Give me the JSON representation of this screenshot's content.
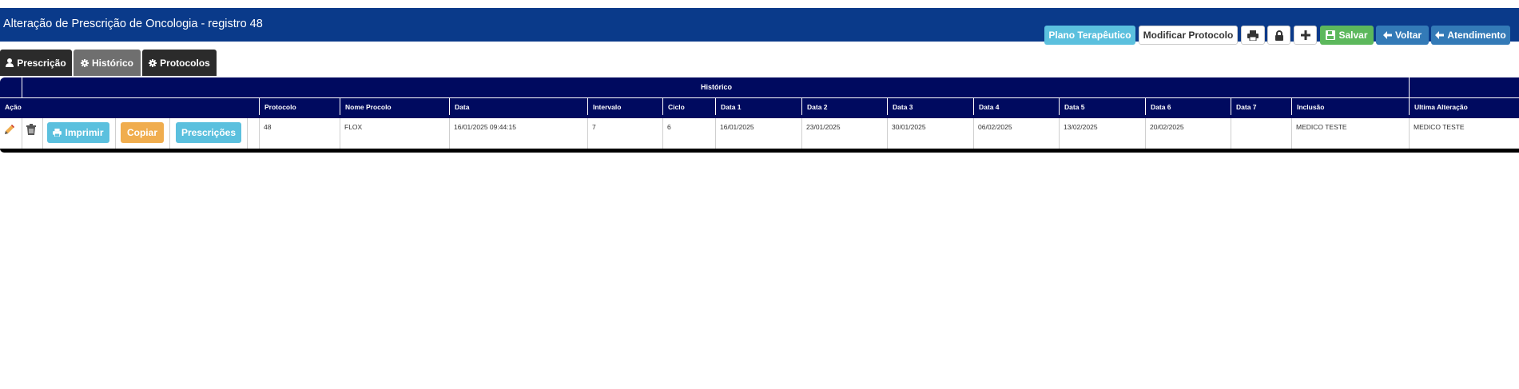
{
  "header": {
    "title": "Alteração de Prescrição de Oncologia - registro 48",
    "plano_label": "Plano Terapêutico",
    "modificar_label": "Modificar Protocolo",
    "salvar_label": "Salvar",
    "voltar_label": "Voltar",
    "atendimento_label": "Atendimento"
  },
  "tabs": [
    {
      "label": "Prescrição",
      "icon": "user-icon"
    },
    {
      "label": "Histórico",
      "icon": "gear-icon",
      "active": true
    },
    {
      "label": "Protocolos",
      "icon": "gear-icon"
    }
  ],
  "table": {
    "title": "Histórico",
    "columns": [
      "Ação",
      "Protocolo",
      "Nome Procolo",
      "Data",
      "Intervalo",
      "Ciclo",
      "Data 1",
      "Data 2",
      "Data 3",
      "Data 4",
      "Data 5",
      "Data 6",
      "Data 7",
      "Inclusão",
      "Ultima Alteração"
    ],
    "row": {
      "protocolo": "48",
      "nome": "FLOX",
      "data": "16/01/2025 09:44:15",
      "intervalo": "7",
      "ciclo": "6",
      "data1": "16/01/2025",
      "data2": "23/01/2025",
      "data3": "30/01/2025",
      "data4": "06/02/2025",
      "data5": "13/02/2025",
      "data6": "20/02/2025",
      "data7": "",
      "inclusao": "MEDICO TESTE",
      "ultima": "MEDICO TESTE"
    },
    "buttons": {
      "imprimir": "Imprimir",
      "copiar": "Copiar",
      "prescricoes": "Prescrições"
    }
  },
  "colors": {
    "header_bg": "#0a3a8a",
    "grid_bg": "#000a5f",
    "info": "#5bc0de",
    "success": "#5cb85c",
    "warning": "#f0ad4e",
    "primary": "#337ab7"
  }
}
